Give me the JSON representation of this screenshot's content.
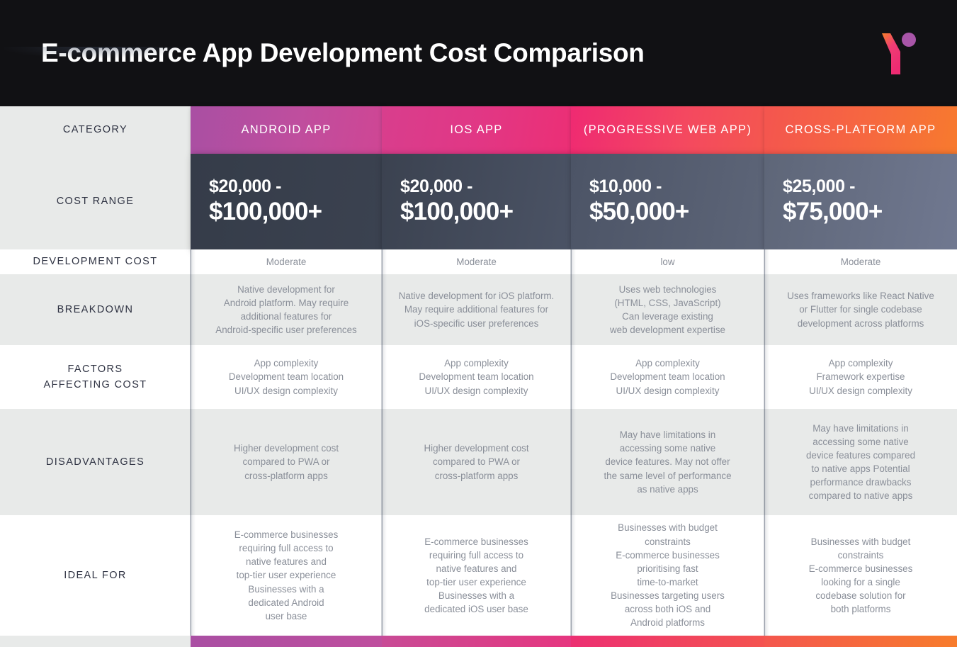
{
  "banner": {
    "title": "E-commerce App Development Cost Comparison",
    "logo_name": "y-logo",
    "background_color": "#111114",
    "logo_gradient_start": "#f7802a",
    "logo_gradient_end": "#ef2a72",
    "logo_dot_color": "#a855a8"
  },
  "columns": [
    {
      "key": "category",
      "label": "CATEGORY",
      "accent": "#e8eae9"
    },
    {
      "key": "android",
      "label": "ANDROID APP",
      "accent": "#bf4e9e"
    },
    {
      "key": "ios",
      "label": "IOS APP",
      "accent": "#e13785"
    },
    {
      "key": "pwa",
      "label": "(PROGRESSIVE WEB APP)",
      "accent": "#f4495f"
    },
    {
      "key": "cross",
      "label": "CROSS-PLATFORM APP",
      "accent": "#f6683f"
    }
  ],
  "rows": {
    "cost_range": {
      "label": "COST RANGE",
      "cells": [
        {
          "top": "$20,000 -",
          "bottom": "$100,000+"
        },
        {
          "top": "$20,000 -",
          "bottom": "$100,000+"
        },
        {
          "top": "$10,000 -",
          "bottom": "$50,000+"
        },
        {
          "top": "$25,000 -",
          "bottom": "$75,000+"
        }
      ]
    },
    "development_cost": {
      "label": "DEVELOPMENT COST",
      "cells": [
        "Moderate",
        "Moderate",
        "low",
        "Moderate"
      ]
    },
    "breakdown": {
      "label": "BREAKDOWN",
      "cells": [
        "Native development for\nAndroid platform. May require\nadditional features for\nAndroid-specific user preferences",
        "Native development for iOS platform.\nMay require additional features for\niOS-specific user preferences",
        "Uses web technologies\n(HTML, CSS, JavaScript)\nCan leverage existing\nweb development expertise",
        "Uses frameworks like React Native\nor Flutter for single codebase\ndevelopment across platforms"
      ]
    },
    "factors_affecting_cost": {
      "label": "FACTORS\nAFFECTING COST",
      "cells": [
        "App complexity\nDevelopment team location\nUI/UX design complexity",
        "App complexity\nDevelopment team location\nUI/UX design complexity",
        "App complexity\nDevelopment team location\nUI/UX design complexity",
        "App complexity\nFramework expertise\nUI/UX design complexity"
      ]
    },
    "disadvantages": {
      "label": "DISADVANTAGES",
      "cells": [
        "Higher development cost\ncompared to PWA or\ncross-platform apps",
        "Higher development cost\ncompared to PWA or\ncross-platform apps",
        "May have limitations in\naccessing some native\ndevice features. May not offer\nthe same level of performance\nas native apps",
        "May have limitations in\naccessing some native\ndevice features compared\nto native apps  Potential\nperformance drawbacks\ncompared to native apps"
      ]
    },
    "ideal_for": {
      "label": "IDEAL FOR",
      "cells": [
        "E-commerce businesses\nrequiring full access to\nnative features and\ntop-tier user experience\nBusinesses with a\ndedicated Android\nuser base",
        "E-commerce businesses\nrequiring full access to\nnative features and\ntop-tier user experience\nBusinesses with a\ndedicated iOS user base",
        "Businesses with budget\nconstraints\nE-commerce businesses\nprioritising fast\ntime-to-market\nBusinesses targeting users\nacross both iOS and\nAndroid platforms",
        "Businesses with budget\nconstraints\nE-commerce businesses\nlooking for a single\ncodebase solution for\nboth platforms"
      ]
    }
  }
}
